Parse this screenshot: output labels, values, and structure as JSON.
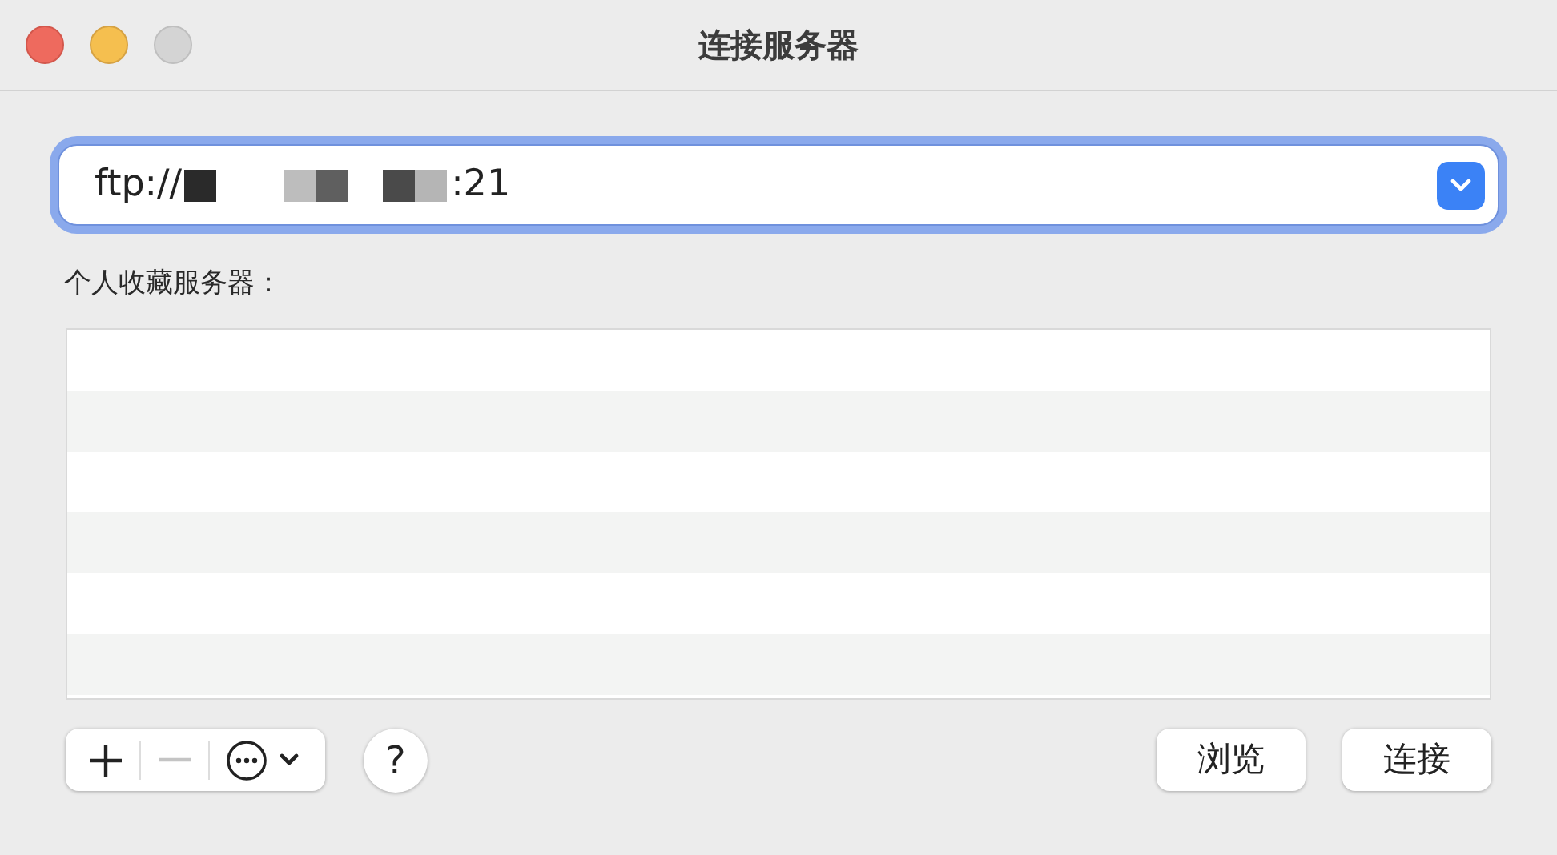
{
  "window": {
    "title": "连接服务器"
  },
  "address": {
    "prefix": "ftp://",
    "suffix": ":21",
    "focused": true
  },
  "favorites": {
    "label": "个人收藏服务器："
  },
  "toolbar": [
    {
      "kind": "add",
      "disabled": false
    },
    {
      "kind": "remove",
      "disabled": true
    },
    {
      "kind": "more",
      "disabled": false
    }
  ],
  "help": "?",
  "buttons": [
    {
      "label": "浏览"
    },
    {
      "label": "连接"
    }
  ]
}
